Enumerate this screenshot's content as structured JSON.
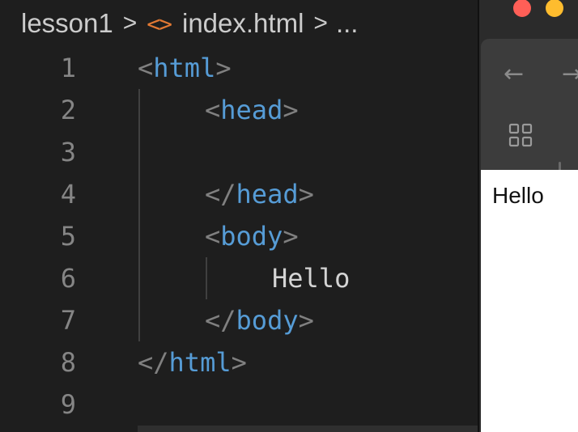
{
  "breadcrumb": {
    "folder": "lesson1",
    "separator": ">",
    "file_icon": "<>",
    "file": "index.html",
    "ellipsis": "..."
  },
  "editor": {
    "lines": [
      {
        "num": "1",
        "tokens": [
          {
            "t": "<",
            "c": "br"
          },
          {
            "t": "html",
            "c": "tag"
          },
          {
            "t": ">",
            "c": "br"
          }
        ],
        "indent": 0
      },
      {
        "num": "2",
        "tokens": [
          {
            "t": "<",
            "c": "br"
          },
          {
            "t": "head",
            "c": "tag"
          },
          {
            "t": ">",
            "c": "br"
          }
        ],
        "indent": 1
      },
      {
        "num": "3",
        "tokens": [],
        "indent": 0
      },
      {
        "num": "4",
        "tokens": [
          {
            "t": "</",
            "c": "br"
          },
          {
            "t": "head",
            "c": "tag"
          },
          {
            "t": ">",
            "c": "br"
          }
        ],
        "indent": 1
      },
      {
        "num": "5",
        "tokens": [
          {
            "t": "<",
            "c": "br"
          },
          {
            "t": "body",
            "c": "tag"
          },
          {
            "t": ">",
            "c": "br"
          }
        ],
        "indent": 1
      },
      {
        "num": "6",
        "tokens": [
          {
            "t": "Hello",
            "c": "txt"
          }
        ],
        "indent": 2
      },
      {
        "num": "7",
        "tokens": [
          {
            "t": "</",
            "c": "br"
          },
          {
            "t": "body",
            "c": "tag"
          },
          {
            "t": ">",
            "c": "br"
          }
        ],
        "indent": 1
      },
      {
        "num": "8",
        "tokens": [
          {
            "t": "</",
            "c": "br"
          },
          {
            "t": "html",
            "c": "tag"
          },
          {
            "t": ">",
            "c": "br"
          }
        ],
        "indent": 0
      },
      {
        "num": "9",
        "tokens": [],
        "indent": 0
      }
    ]
  },
  "browser": {
    "traffic_lights": {
      "close": "#ff5f57",
      "minimize": "#febc2e",
      "zoom": "#28c840"
    },
    "back_icon": "←",
    "forward_icon": "→",
    "tabs_icon": "grid-icon",
    "page_text": "Hello"
  },
  "colors": {
    "editor_bg": "#1e1e1e",
    "tag": "#569cd6",
    "bracket": "#808080",
    "text": "#d4d4d4",
    "line_number": "#858585",
    "file_icon": "#e37933"
  }
}
